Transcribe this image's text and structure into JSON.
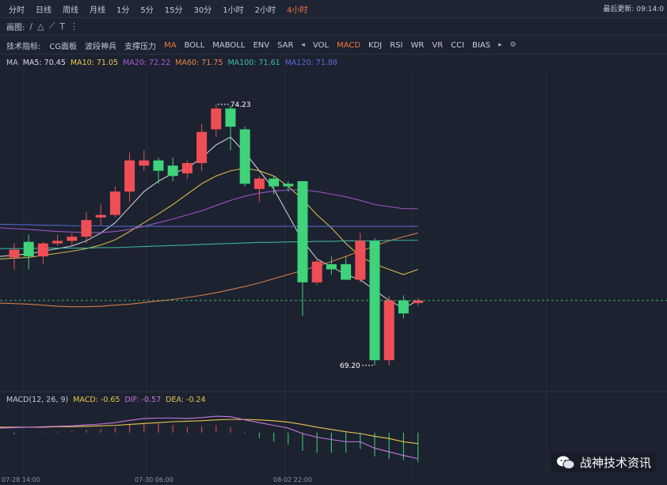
{
  "header": {
    "timeframes": [
      "分时",
      "日线",
      "周线",
      "月线",
      "1分",
      "5分",
      "15分",
      "30分",
      "1小时",
      "2小时",
      "4小时"
    ],
    "active_timeframe": "4小时",
    "update_text": "最后更新: 09:14:0"
  },
  "draw_toolbar": {
    "label": "画图:"
  },
  "indicator_toolbar": {
    "label": "技术指标:",
    "items": [
      "CG面板",
      "波段神兵",
      "支撑压力",
      "MA",
      "BOLL",
      "MABOLL",
      "ENV",
      "SAR",
      "VOL",
      "MACD",
      "KDJ",
      "RSI",
      "WR",
      "VR",
      "CCI",
      "BIAS"
    ],
    "active": [
      "MA",
      "MACD"
    ]
  },
  "ma_legend": {
    "title": "MA",
    "items": [
      {
        "text": "MA5: 70.45",
        "color": "#d9dde6"
      },
      {
        "text": "MA10: 71.05",
        "color": "#e8c64a"
      },
      {
        "text": "MA20: 72.22",
        "color": "#a85bd6"
      },
      {
        "text": "MA60: 71.75",
        "color": "#e9864b"
      },
      {
        "text": "MA100: 71.61",
        "color": "#3fbfa7"
      },
      {
        "text": "MA120: 71.88",
        "color": "#5a6bdc"
      }
    ]
  },
  "macd_legend": {
    "title": "MACD(12, 26, 9)",
    "items": [
      {
        "text": "MACD: -0.65",
        "color": "#e8c64a"
      },
      {
        "text": "DIF: -0.57",
        "color": "#c678dd"
      },
      {
        "text": "DEA: -0.24",
        "color": "#e8c64a"
      }
    ]
  },
  "x_labels": [
    "07-28 14:00",
    "07-30 06:00",
    "08-02 22:00"
  ],
  "watermark": "战神技术资讯",
  "colors": {
    "up": "#f04e56",
    "down": "#3fd37a",
    "bg": "#1c2230"
  },
  "chart_data": {
    "type": "candlestick",
    "price_range": [
      68.8,
      74.9
    ],
    "max_label": "74.23",
    "min_label": "69.20",
    "current_price": 70.45,
    "candles": [
      {
        "o": 71.28,
        "h": 71.55,
        "l": 71.05,
        "c": 71.43
      },
      {
        "o": 71.58,
        "h": 71.72,
        "l": 71.05,
        "c": 71.3
      },
      {
        "o": 71.3,
        "h": 71.58,
        "l": 71.15,
        "c": 71.55
      },
      {
        "o": 71.55,
        "h": 71.72,
        "l": 71.5,
        "c": 71.6
      },
      {
        "o": 71.6,
        "h": 71.75,
        "l": 71.52,
        "c": 71.68
      },
      {
        "o": 71.68,
        "h": 72.15,
        "l": 71.55,
        "c": 72.0
      },
      {
        "o": 72.05,
        "h": 72.3,
        "l": 71.9,
        "c": 72.1
      },
      {
        "o": 72.1,
        "h": 72.65,
        "l": 72.05,
        "c": 72.55
      },
      {
        "o": 72.55,
        "h": 73.3,
        "l": 72.35,
        "c": 73.15
      },
      {
        "o": 73.05,
        "h": 73.35,
        "l": 72.95,
        "c": 73.15
      },
      {
        "o": 73.15,
        "h": 73.2,
        "l": 72.7,
        "c": 72.95
      },
      {
        "o": 73.05,
        "h": 73.2,
        "l": 72.75,
        "c": 72.85
      },
      {
        "o": 72.9,
        "h": 73.15,
        "l": 72.8,
        "c": 73.1
      },
      {
        "o": 73.1,
        "h": 73.85,
        "l": 72.95,
        "c": 73.7
      },
      {
        "o": 73.75,
        "h": 74.23,
        "l": 73.6,
        "c": 74.15
      },
      {
        "o": 74.15,
        "h": 74.2,
        "l": 73.35,
        "c": 73.8
      },
      {
        "o": 73.75,
        "h": 73.8,
        "l": 72.65,
        "c": 72.7
      },
      {
        "o": 72.6,
        "h": 72.85,
        "l": 72.35,
        "c": 72.8
      },
      {
        "o": 72.8,
        "h": 72.85,
        "l": 72.5,
        "c": 72.65
      },
      {
        "o": 72.7,
        "h": 72.75,
        "l": 72.55,
        "c": 72.65
      },
      {
        "o": 72.75,
        "h": 72.75,
        "l": 70.15,
        "c": 70.8
      },
      {
        "o": 70.8,
        "h": 71.25,
        "l": 70.75,
        "c": 71.2
      },
      {
        "o": 71.15,
        "h": 71.3,
        "l": 70.95,
        "c": 71.05
      },
      {
        "o": 71.15,
        "h": 71.3,
        "l": 70.85,
        "c": 70.85
      },
      {
        "o": 70.85,
        "h": 71.75,
        "l": 70.8,
        "c": 71.6
      },
      {
        "o": 71.6,
        "h": 71.65,
        "l": 69.2,
        "c": 69.3
      },
      {
        "o": 69.3,
        "h": 70.55,
        "l": 69.2,
        "c": 70.45
      },
      {
        "o": 70.45,
        "h": 70.55,
        "l": 70.1,
        "c": 70.2
      },
      {
        "o": 70.4,
        "h": 70.5,
        "l": 70.35,
        "c": 70.45
      }
    ],
    "ma_lines": [
      {
        "name": "MA5",
        "color": "#d9dde6",
        "values": [
          71.3,
          71.35,
          71.4,
          71.45,
          71.5,
          71.6,
          71.75,
          71.95,
          72.25,
          72.55,
          72.75,
          72.9,
          73.0,
          73.2,
          73.45,
          73.6,
          73.3,
          72.95,
          72.6,
          72.1,
          71.6,
          71.25,
          71.1,
          70.95,
          70.85,
          70.65,
          70.45,
          70.3,
          70.45
        ]
      },
      {
        "name": "MA10",
        "color": "#e8c64a",
        "values": [
          71.25,
          71.28,
          71.32,
          71.36,
          71.4,
          71.45,
          71.52,
          71.62,
          71.78,
          71.95,
          72.12,
          72.3,
          72.5,
          72.7,
          72.85,
          72.95,
          73.0,
          72.95,
          72.85,
          72.65,
          72.4,
          72.1,
          71.85,
          71.55,
          71.3,
          71.15,
          71.05,
          70.95,
          71.05
        ]
      },
      {
        "name": "MA20",
        "color": "#a85bd6",
        "values": [
          71.85,
          71.82,
          71.8,
          71.78,
          71.77,
          71.76,
          71.76,
          71.78,
          71.82,
          71.88,
          71.95,
          72.02,
          72.1,
          72.18,
          72.28,
          72.38,
          72.46,
          72.52,
          72.56,
          72.58,
          72.58,
          72.55,
          72.5,
          72.45,
          72.38,
          72.3,
          72.26,
          72.22,
          72.22
        ]
      },
      {
        "name": "MA60",
        "color": "#e9864b",
        "values": [
          70.4,
          70.38,
          70.36,
          70.34,
          70.33,
          70.33,
          70.34,
          70.36,
          70.38,
          70.41,
          70.44,
          70.47,
          70.51,
          70.55,
          70.6,
          70.66,
          70.72,
          70.79,
          70.87,
          70.95,
          71.03,
          71.11,
          71.2,
          71.3,
          71.4,
          71.5,
          71.6,
          71.68,
          71.75
        ]
      },
      {
        "name": "MA100",
        "color": "#3fbfa7",
        "values": [
          71.45,
          71.45,
          71.46,
          71.46,
          71.46,
          71.46,
          71.47,
          71.47,
          71.48,
          71.49,
          71.5,
          71.51,
          71.52,
          71.53,
          71.54,
          71.55,
          71.56,
          71.57,
          71.57,
          71.58,
          71.58,
          71.59,
          71.59,
          71.6,
          71.6,
          71.6,
          71.61,
          71.61,
          71.61
        ]
      },
      {
        "name": "MA120",
        "color": "#5a6bdc",
        "values": [
          71.92,
          71.91,
          71.9,
          71.9,
          71.89,
          71.89,
          71.89,
          71.88,
          71.88,
          71.88,
          71.88,
          71.88,
          71.88,
          71.88,
          71.88,
          71.88,
          71.88,
          71.88,
          71.88,
          71.88,
          71.88,
          71.88,
          71.88,
          71.88,
          71.88,
          71.88,
          71.88,
          71.88,
          71.88
        ]
      }
    ],
    "macd": {
      "dif": [
        0.1,
        0.12,
        0.13,
        0.14,
        0.15,
        0.17,
        0.19,
        0.22,
        0.27,
        0.31,
        0.32,
        0.32,
        0.31,
        0.33,
        0.36,
        0.35,
        0.28,
        0.22,
        0.16,
        0.1,
        -0.02,
        -0.1,
        -0.15,
        -0.2,
        -0.2,
        -0.34,
        -0.42,
        -0.5,
        -0.57
      ],
      "dea": [
        0.12,
        0.12,
        0.12,
        0.13,
        0.13,
        0.14,
        0.15,
        0.16,
        0.18,
        0.2,
        0.22,
        0.24,
        0.25,
        0.26,
        0.28,
        0.29,
        0.29,
        0.28,
        0.26,
        0.23,
        0.18,
        0.12,
        0.07,
        0.02,
        -0.02,
        -0.08,
        -0.13,
        -0.2,
        -0.24
      ],
      "hist": [
        -0.04,
        0.0,
        0.02,
        0.02,
        0.04,
        0.06,
        0.08,
        0.12,
        0.18,
        0.22,
        0.2,
        0.16,
        0.12,
        0.14,
        0.16,
        0.12,
        -0.02,
        -0.12,
        -0.2,
        -0.26,
        -0.4,
        -0.44,
        -0.44,
        -0.44,
        -0.36,
        -0.52,
        -0.58,
        -0.6,
        -0.65
      ]
    }
  }
}
